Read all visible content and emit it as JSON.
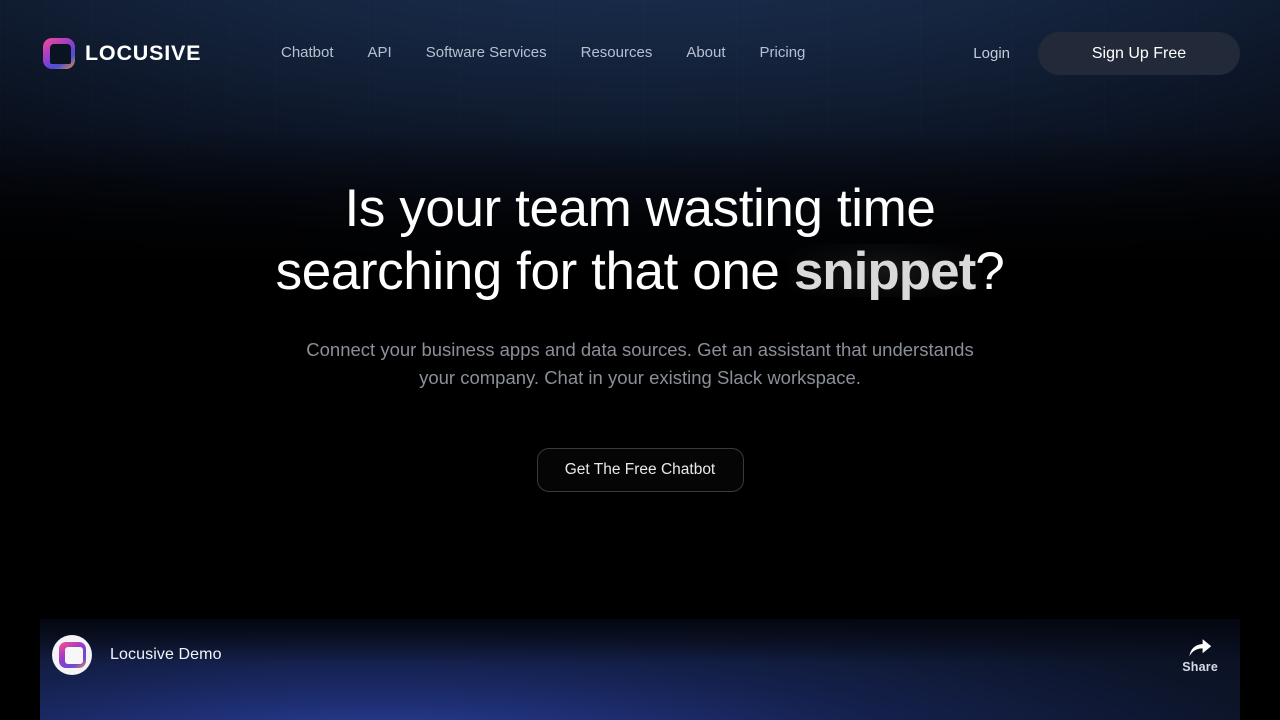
{
  "header": {
    "brand_name": "LOCUSIVE",
    "logo_icon": "locusive-logo-icon",
    "nav_items": [
      {
        "label": "Chatbot"
      },
      {
        "label": "API"
      },
      {
        "label": "Software Services"
      },
      {
        "label": "Resources"
      },
      {
        "label": "About"
      },
      {
        "label": "Pricing"
      }
    ],
    "login_label": "Login",
    "signup_label": "Sign Up Free"
  },
  "hero": {
    "headline_line1": "Is your team wasting time",
    "headline_line2_before": "searching for that one ",
    "headline_emphasis": "snippet",
    "headline_line2_after": "?",
    "subhead_line1": "Connect your business apps and data sources. Get an assistant that understands",
    "subhead_line2": "your company. Chat in your existing Slack workspace.",
    "cta_label": "Get The Free Chatbot"
  },
  "video": {
    "title": "Locusive Demo",
    "avatar_icon": "locusive-avatar-icon",
    "share_icon": "share-arrow-icon",
    "share_label": "Share"
  },
  "colors": {
    "page_background": "#000000",
    "header_glow": "#1d3258",
    "signup_button": "#222a39",
    "nav_text": "#b6c0d0",
    "subhead_text": "#8a8f98",
    "emphasis_text": "#d9d9d9",
    "video_panel_blue": "#2f46a8"
  }
}
